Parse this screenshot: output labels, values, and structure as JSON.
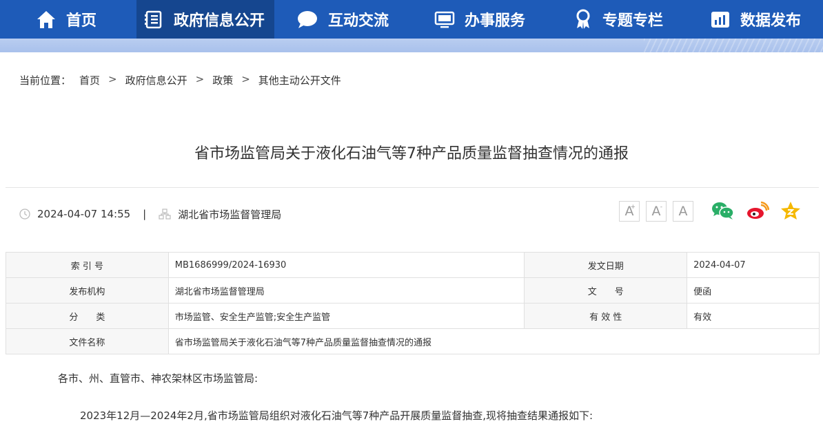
{
  "nav": {
    "items": [
      {
        "label": "首页",
        "icon": "home-icon"
      },
      {
        "label": "政府信息公开",
        "icon": "document-icon"
      },
      {
        "label": "互动交流",
        "icon": "chat-bubble-icon"
      },
      {
        "label": "办事服务",
        "icon": "monitor-icon"
      },
      {
        "label": "专题专栏",
        "icon": "award-icon"
      },
      {
        "label": "数据发布",
        "icon": "bar-chart-icon"
      }
    ],
    "active": 1
  },
  "breadcrumb": {
    "prefix": "当前位置：",
    "items": [
      "首页",
      "政府信息公开",
      "政策",
      "其他主动公开文件"
    ],
    "separator": ">"
  },
  "article": {
    "title": "省市场监管局关于液化石油气等7种产品质量监督抽查情况的通报",
    "datetime": "2024-04-07 14:55",
    "divider": "|",
    "source": "湖北省市场监督管理局"
  },
  "font_controls": {
    "increase": "A",
    "default": "A",
    "decrease": "A",
    "plus": "+",
    "minus": "-"
  },
  "share": [
    "wechat-icon",
    "weibo-icon",
    "favorite-star-icon"
  ],
  "info_table": {
    "rows": [
      {
        "l1": "索 引 号",
        "v1": "MB1686999/2024-16930",
        "l2": "发文日期",
        "v2": "2024-04-07"
      },
      {
        "l1": "发布机构",
        "v1": "湖北省市场监督管理局",
        "l2": "文　　号",
        "v2": "便函"
      },
      {
        "l1": "分　　类",
        "v1": "市场监管、安全生产监管;安全生产监管",
        "l2": "有 效 性",
        "v2": "有效"
      }
    ],
    "file_label": "文件名称",
    "file_value": "省市场监管局关于液化石油气等7种产品质量监督抽查情况的通报"
  },
  "content": {
    "salutation": "各市、州、直管市、神农架林区市场监管局:",
    "paragraph1": "2023年12月—2024年2月,省市场监管局组织对液化石油气等7种产品开展质量监督抽查,现将抽查结果通报如下:"
  },
  "colors": {
    "nav_bg": "#1e5bb8",
    "nav_active": "#15468f",
    "stripe": "#b3c9ef",
    "wechat": "#2aae67",
    "weibo": "#e6162d",
    "star": "#f5b800"
  }
}
